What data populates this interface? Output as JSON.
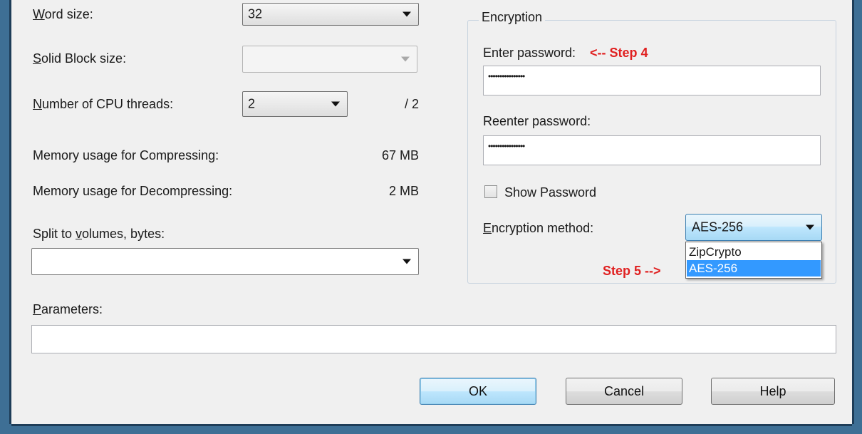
{
  "left": {
    "word_size": {
      "label": "Word size:",
      "mnemonic": "W",
      "label_rest": "ord size:",
      "value": "32"
    },
    "solid_block": {
      "label": "Solid Block size:",
      "mnemonic": "S",
      "label_rest": "olid Block size:",
      "value": ""
    },
    "cpu_threads": {
      "label": "Number of CPU threads:",
      "mnemonic": "N",
      "label_rest": "umber of CPU threads:",
      "value": "2",
      "max": "/ 2"
    },
    "mem_compress": {
      "label": "Memory usage for Compressing:",
      "value": "67 MB"
    },
    "mem_decompress": {
      "label": "Memory usage for Decompressing:",
      "value": "2 MB"
    },
    "split_volumes": {
      "label_pre": "Split to ",
      "mnemonic": "v",
      "label_rest": "olumes, bytes:",
      "value": ""
    },
    "parameters": {
      "mnemonic": "P",
      "label_rest": "arameters:",
      "value": ""
    }
  },
  "encryption": {
    "title": "Encryption",
    "enter_password_label": "Enter password:",
    "enter_password_value": "••••••••••••••••",
    "step4": "<-- Step 4",
    "reenter_password_label": "Reenter password:",
    "reenter_password_value": "••••••••••••••••",
    "show_password_label": "Show Password",
    "method_mnemonic": "E",
    "method_label_rest": "ncryption method:",
    "method_value": "AES-256",
    "options": [
      "ZipCrypto",
      "AES-256"
    ],
    "step5": "Step 5 -->"
  },
  "buttons": {
    "ok": "OK",
    "cancel": "Cancel",
    "help": "Help"
  }
}
